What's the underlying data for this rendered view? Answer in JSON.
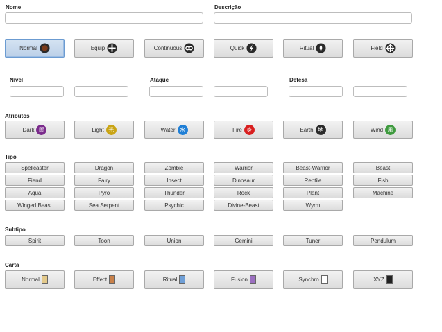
{
  "labels": {
    "nome": "Nome",
    "descricao": "Descrição",
    "nivel": "Nível",
    "ataque": "Ataque",
    "defesa": "Defesa",
    "atributos": "Atributos",
    "tipo": "Tipo",
    "subtipo": "Subtipo",
    "carta": "Carta"
  },
  "fields": {
    "nome": "",
    "descricao": "",
    "nivel_min": "",
    "nivel_max": "",
    "ataque_min": "",
    "ataque_max": "",
    "defesa_min": "",
    "defesa_max": ""
  },
  "spell_types": [
    {
      "label": "Normal",
      "icon": "normal-spell-icon"
    },
    {
      "label": "Equip",
      "icon": "equip-icon"
    },
    {
      "label": "Continuous",
      "icon": "continuous-icon"
    },
    {
      "label": "Quick",
      "icon": "quick-play-icon"
    },
    {
      "label": "Ritual",
      "icon": "ritual-icon"
    },
    {
      "label": "Field",
      "icon": "field-icon"
    }
  ],
  "attributes": [
    {
      "label": "Dark",
      "glyph": "闇",
      "color": "#7b2b8c"
    },
    {
      "label": "Light",
      "glyph": "光",
      "color": "#c9a414"
    },
    {
      "label": "Water",
      "glyph": "水",
      "color": "#1f7fd6"
    },
    {
      "label": "Fire",
      "glyph": "炎",
      "color": "#d81f1f"
    },
    {
      "label": "Earth",
      "glyph": "地",
      "color": "#2b2b2b"
    },
    {
      "label": "Wind",
      "glyph": "風",
      "color": "#3e9a3e"
    }
  ],
  "types": [
    "Spellcaster",
    "Dragon",
    "Zombie",
    "Warrior",
    "Beast-Warrior",
    "Beast",
    "Fiend",
    "Fairy",
    "Insect",
    "Dinosaur",
    "Reptile",
    "Fish",
    "Aqua",
    "Pyro",
    "Thunder",
    "Rock",
    "Plant",
    "Machine",
    "Winged Beast",
    "Sea Serpent",
    "Psychic",
    "Divine-Beast",
    "Wyrm"
  ],
  "subtypes": [
    "Spirit",
    "Toon",
    "Union",
    "Gemini",
    "Tuner",
    "Pendulum"
  ],
  "cards": [
    {
      "label": "Normal",
      "color": "#e3c98a"
    },
    {
      "label": "Effect",
      "color": "#c9814a"
    },
    {
      "label": "Ritual",
      "color": "#6f9fd6"
    },
    {
      "label": "Fusion",
      "color": "#9b6fc0"
    },
    {
      "label": "Synchro",
      "color": "#ffffff"
    },
    {
      "label": "XYZ",
      "color": "#222222"
    }
  ]
}
